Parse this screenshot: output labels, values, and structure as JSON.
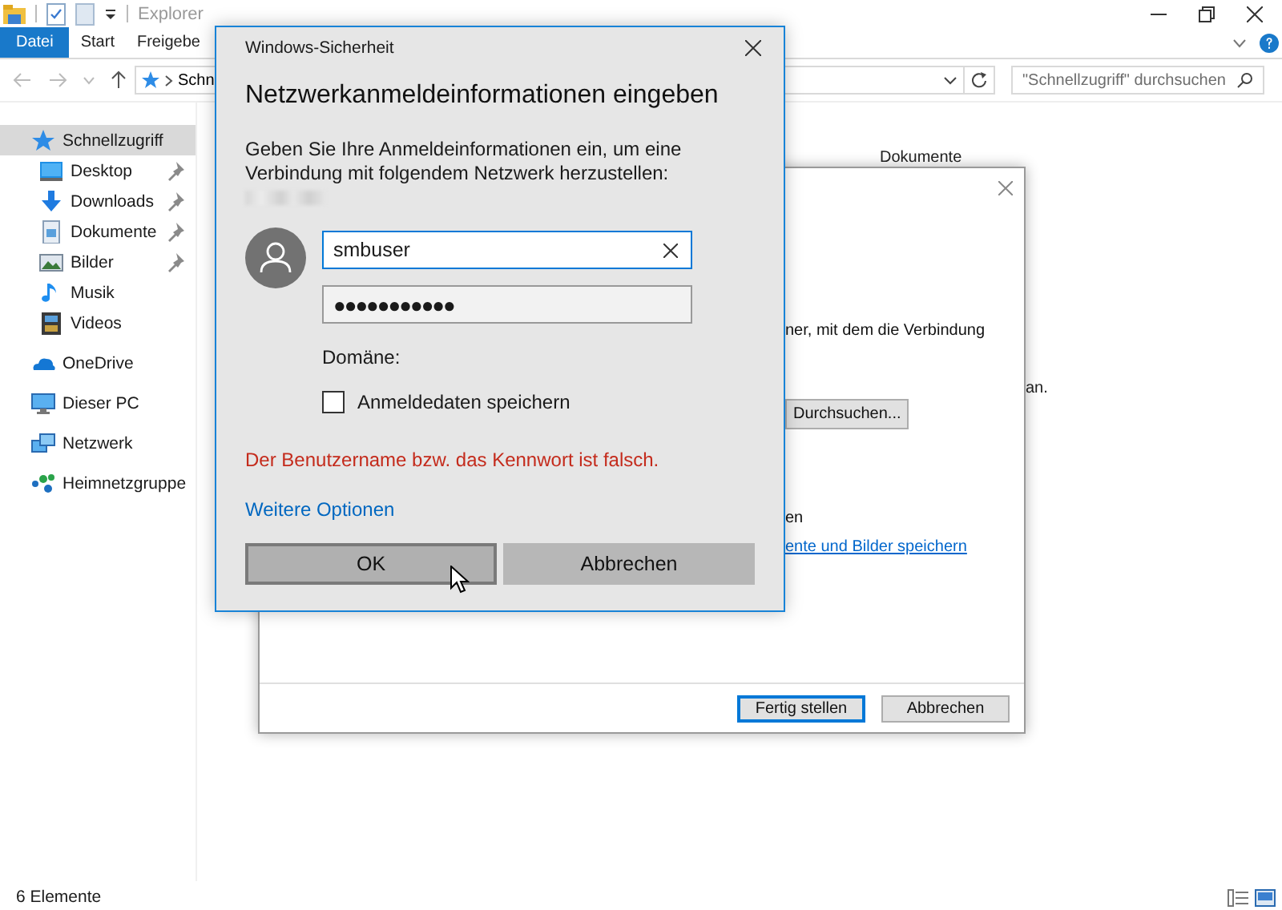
{
  "explorer": {
    "title": "Explorer",
    "ribbon_tabs": [
      {
        "label": "Datei",
        "selected": true
      },
      {
        "label": "Start",
        "selected": false
      },
      {
        "label": "Freigebe",
        "selected": false
      }
    ],
    "address": "Schn",
    "search": {
      "placeholder": "\"Schnellzugriff\" durchsuchen"
    },
    "nav": [
      {
        "label": "Schnellzugriff",
        "selected": true,
        "children": [
          {
            "label": "Desktop",
            "pinned": true
          },
          {
            "label": "Downloads",
            "pinned": true
          },
          {
            "label": "Dokumente",
            "pinned": true
          },
          {
            "label": "Bilder",
            "pinned": true
          },
          {
            "label": "Musik",
            "pinned": false
          },
          {
            "label": "Videos",
            "pinned": false
          }
        ]
      },
      {
        "label": "OneDrive",
        "selected": false
      },
      {
        "label": "Dieser PC",
        "selected": false
      },
      {
        "label": "Netzwerk",
        "selected": false
      },
      {
        "label": "Heimnetzgruppe",
        "selected": false
      }
    ],
    "content_item": "Dokumente",
    "content_fragment": "an.",
    "status": "6 Elemente"
  },
  "wizard": {
    "description_fragment": "ner, mit dem die Verbindung",
    "browse_button": "Durchsuchen...",
    "option_fragment": "en",
    "link_fragment": "ente und Bilder speichern",
    "buttons": [
      {
        "label": "Fertig stellen",
        "selected": true
      },
      {
        "label": "Abbrechen",
        "selected": false
      }
    ]
  },
  "dialog": {
    "title": "Windows-Sicherheit",
    "heading": "Netzwerkanmeldeinformationen eingeben",
    "message": "Geben Sie Ihre Anmeldeinformationen ein, um eine Verbindung mit folgendem Netzwerk herzustellen:",
    "username": "smbuser",
    "password": "●●●●●●●●●●●",
    "domain_label": "Domäne:",
    "remember": {
      "label": "Anmeldedaten speichern",
      "checked": false
    },
    "error": "Der Benutzername bzw. das Kennwort ist falsch.",
    "more_options": "Weitere Optionen",
    "buttons": [
      {
        "label": "OK",
        "selected": true
      },
      {
        "label": "Abbrechen",
        "selected": false
      }
    ]
  }
}
